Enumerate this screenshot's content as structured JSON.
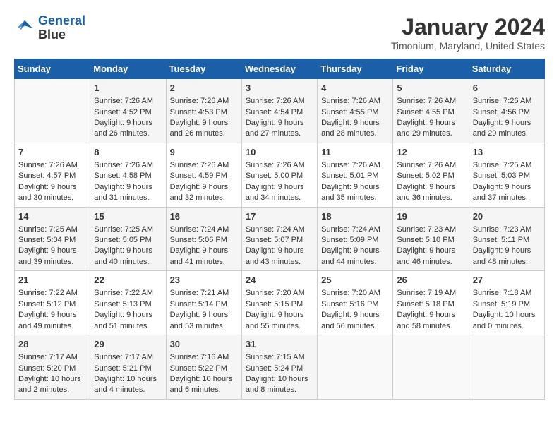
{
  "header": {
    "logo_line1": "General",
    "logo_line2": "Blue",
    "month_title": "January 2024",
    "location": "Timonium, Maryland, United States"
  },
  "days_of_week": [
    "Sunday",
    "Monday",
    "Tuesday",
    "Wednesday",
    "Thursday",
    "Friday",
    "Saturday"
  ],
  "weeks": [
    [
      {
        "day": "",
        "empty": true
      },
      {
        "day": "1",
        "sunrise": "Sunrise: 7:26 AM",
        "sunset": "Sunset: 4:52 PM",
        "daylight": "Daylight: 9 hours and 26 minutes."
      },
      {
        "day": "2",
        "sunrise": "Sunrise: 7:26 AM",
        "sunset": "Sunset: 4:53 PM",
        "daylight": "Daylight: 9 hours and 26 minutes."
      },
      {
        "day": "3",
        "sunrise": "Sunrise: 7:26 AM",
        "sunset": "Sunset: 4:54 PM",
        "daylight": "Daylight: 9 hours and 27 minutes."
      },
      {
        "day": "4",
        "sunrise": "Sunrise: 7:26 AM",
        "sunset": "Sunset: 4:55 PM",
        "daylight": "Daylight: 9 hours and 28 minutes."
      },
      {
        "day": "5",
        "sunrise": "Sunrise: 7:26 AM",
        "sunset": "Sunset: 4:55 PM",
        "daylight": "Daylight: 9 hours and 29 minutes."
      },
      {
        "day": "6",
        "sunrise": "Sunrise: 7:26 AM",
        "sunset": "Sunset: 4:56 PM",
        "daylight": "Daylight: 9 hours and 29 minutes."
      }
    ],
    [
      {
        "day": "7",
        "sunrise": "Sunrise: 7:26 AM",
        "sunset": "Sunset: 4:57 PM",
        "daylight": "Daylight: 9 hours and 30 minutes."
      },
      {
        "day": "8",
        "sunrise": "Sunrise: 7:26 AM",
        "sunset": "Sunset: 4:58 PM",
        "daylight": "Daylight: 9 hours and 31 minutes."
      },
      {
        "day": "9",
        "sunrise": "Sunrise: 7:26 AM",
        "sunset": "Sunset: 4:59 PM",
        "daylight": "Daylight: 9 hours and 32 minutes."
      },
      {
        "day": "10",
        "sunrise": "Sunrise: 7:26 AM",
        "sunset": "Sunset: 5:00 PM",
        "daylight": "Daylight: 9 hours and 34 minutes."
      },
      {
        "day": "11",
        "sunrise": "Sunrise: 7:26 AM",
        "sunset": "Sunset: 5:01 PM",
        "daylight": "Daylight: 9 hours and 35 minutes."
      },
      {
        "day": "12",
        "sunrise": "Sunrise: 7:26 AM",
        "sunset": "Sunset: 5:02 PM",
        "daylight": "Daylight: 9 hours and 36 minutes."
      },
      {
        "day": "13",
        "sunrise": "Sunrise: 7:25 AM",
        "sunset": "Sunset: 5:03 PM",
        "daylight": "Daylight: 9 hours and 37 minutes."
      }
    ],
    [
      {
        "day": "14",
        "sunrise": "Sunrise: 7:25 AM",
        "sunset": "Sunset: 5:04 PM",
        "daylight": "Daylight: 9 hours and 39 minutes."
      },
      {
        "day": "15",
        "sunrise": "Sunrise: 7:25 AM",
        "sunset": "Sunset: 5:05 PM",
        "daylight": "Daylight: 9 hours and 40 minutes."
      },
      {
        "day": "16",
        "sunrise": "Sunrise: 7:24 AM",
        "sunset": "Sunset: 5:06 PM",
        "daylight": "Daylight: 9 hours and 41 minutes."
      },
      {
        "day": "17",
        "sunrise": "Sunrise: 7:24 AM",
        "sunset": "Sunset: 5:07 PM",
        "daylight": "Daylight: 9 hours and 43 minutes."
      },
      {
        "day": "18",
        "sunrise": "Sunrise: 7:24 AM",
        "sunset": "Sunset: 5:09 PM",
        "daylight": "Daylight: 9 hours and 44 minutes."
      },
      {
        "day": "19",
        "sunrise": "Sunrise: 7:23 AM",
        "sunset": "Sunset: 5:10 PM",
        "daylight": "Daylight: 9 hours and 46 minutes."
      },
      {
        "day": "20",
        "sunrise": "Sunrise: 7:23 AM",
        "sunset": "Sunset: 5:11 PM",
        "daylight": "Daylight: 9 hours and 48 minutes."
      }
    ],
    [
      {
        "day": "21",
        "sunrise": "Sunrise: 7:22 AM",
        "sunset": "Sunset: 5:12 PM",
        "daylight": "Daylight: 9 hours and 49 minutes."
      },
      {
        "day": "22",
        "sunrise": "Sunrise: 7:22 AM",
        "sunset": "Sunset: 5:13 PM",
        "daylight": "Daylight: 9 hours and 51 minutes."
      },
      {
        "day": "23",
        "sunrise": "Sunrise: 7:21 AM",
        "sunset": "Sunset: 5:14 PM",
        "daylight": "Daylight: 9 hours and 53 minutes."
      },
      {
        "day": "24",
        "sunrise": "Sunrise: 7:20 AM",
        "sunset": "Sunset: 5:15 PM",
        "daylight": "Daylight: 9 hours and 55 minutes."
      },
      {
        "day": "25",
        "sunrise": "Sunrise: 7:20 AM",
        "sunset": "Sunset: 5:16 PM",
        "daylight": "Daylight: 9 hours and 56 minutes."
      },
      {
        "day": "26",
        "sunrise": "Sunrise: 7:19 AM",
        "sunset": "Sunset: 5:18 PM",
        "daylight": "Daylight: 9 hours and 58 minutes."
      },
      {
        "day": "27",
        "sunrise": "Sunrise: 7:18 AM",
        "sunset": "Sunset: 5:19 PM",
        "daylight": "Daylight: 10 hours and 0 minutes."
      }
    ],
    [
      {
        "day": "28",
        "sunrise": "Sunrise: 7:17 AM",
        "sunset": "Sunset: 5:20 PM",
        "daylight": "Daylight: 10 hours and 2 minutes."
      },
      {
        "day": "29",
        "sunrise": "Sunrise: 7:17 AM",
        "sunset": "Sunset: 5:21 PM",
        "daylight": "Daylight: 10 hours and 4 minutes."
      },
      {
        "day": "30",
        "sunrise": "Sunrise: 7:16 AM",
        "sunset": "Sunset: 5:22 PM",
        "daylight": "Daylight: 10 hours and 6 minutes."
      },
      {
        "day": "31",
        "sunrise": "Sunrise: 7:15 AM",
        "sunset": "Sunset: 5:24 PM",
        "daylight": "Daylight: 10 hours and 8 minutes."
      },
      {
        "day": "",
        "empty": true
      },
      {
        "day": "",
        "empty": true
      },
      {
        "day": "",
        "empty": true
      }
    ]
  ]
}
